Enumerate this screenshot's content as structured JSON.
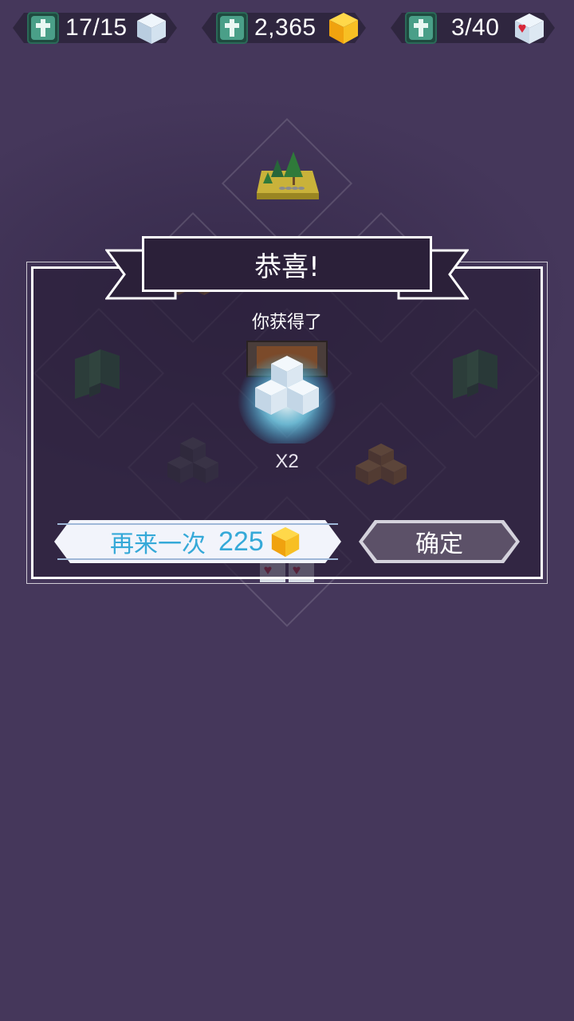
{
  "resources": [
    {
      "value": "17/15",
      "icon": "ice-cube-icon",
      "add_icon": "plus-icon"
    },
    {
      "value": "2,365",
      "icon": "gold-gem-icon",
      "add_icon": "plus-icon"
    },
    {
      "value": "3/40",
      "icon": "heart-cube-icon",
      "add_icon": "plus-icon"
    }
  ],
  "dialog": {
    "title": "恭喜!",
    "subtitle": "你获得了",
    "reward_icon": "ice-cube-stack-icon",
    "quantity": "X2",
    "retry_label": "再来一次",
    "retry_cost": "225",
    "retry_cost_icon": "gold-gem-icon",
    "confirm_label": "确定"
  },
  "colors": {
    "background": "#45375b",
    "accent_blue": "#35a9d8",
    "gold": "#f5b21d",
    "green_block": "#2e8a3a"
  }
}
